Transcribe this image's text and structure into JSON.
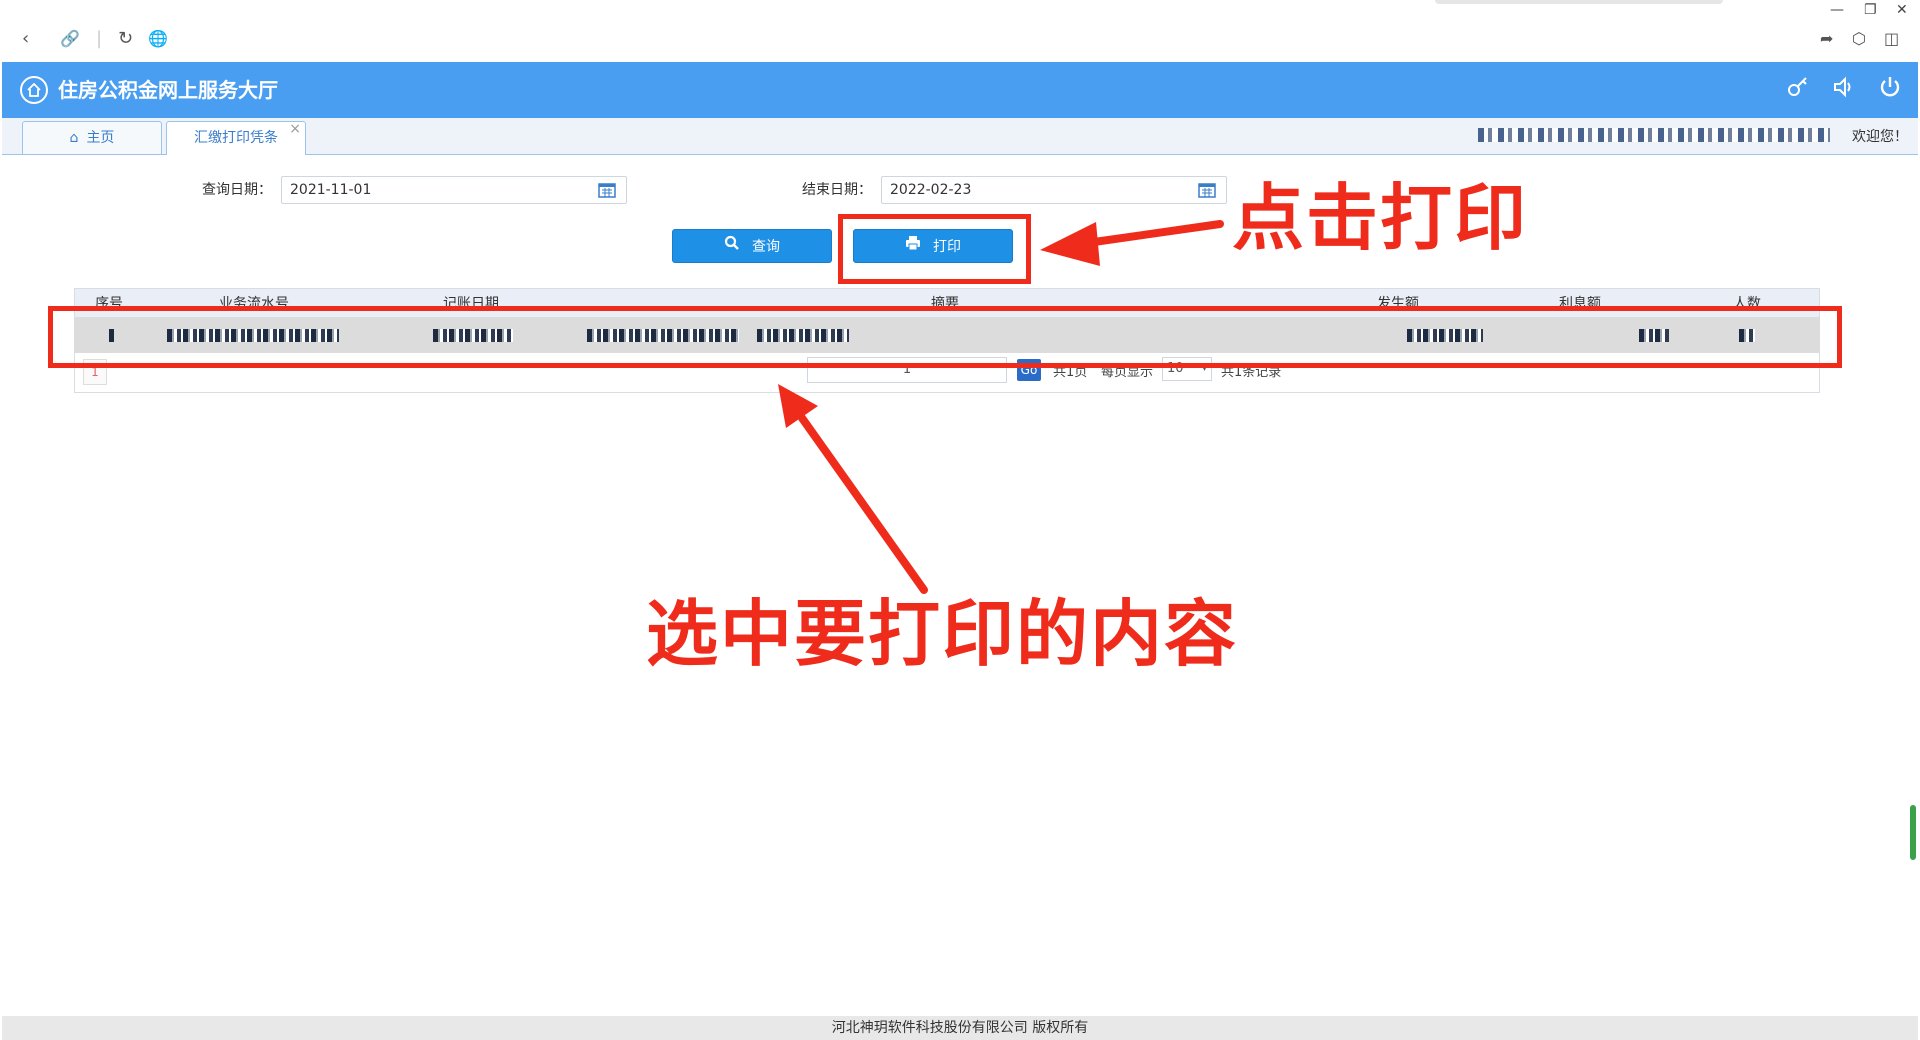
{
  "header": {
    "title": "住房公积金网上服务大厅"
  },
  "tabs": [
    {
      "label": "主页",
      "active": false
    },
    {
      "label": "汇缴打印凭条",
      "active": true,
      "close": "×"
    }
  ],
  "welcome": "欢迎您！",
  "form": {
    "start_label": "查询日期：",
    "start_value": "2021-11-01",
    "end_label": "结束日期：",
    "end_value": "2022-02-23",
    "query_button": "查询",
    "print_button": "打印"
  },
  "table": {
    "columns": [
      "序号",
      "业务流水号",
      "记账日期",
      "摘要",
      "发生额",
      "利息额",
      "人数"
    ]
  },
  "pager": {
    "page_button": "1",
    "page_input": "1",
    "go": "Go",
    "total_pages": "共1页",
    "per_page_label": "每页显示",
    "per_page_value": "10",
    "total_records": "共1条记录"
  },
  "annotations": {
    "click_print": "点击打印",
    "select_content": "选中要打印的内容"
  },
  "footer": "河北神玥软件科技股份有限公司 版权所有",
  "colors": {
    "header_blue": "#4a9ef2",
    "button_blue": "#1e90e6",
    "annotation_red": "#ef2b1c"
  }
}
